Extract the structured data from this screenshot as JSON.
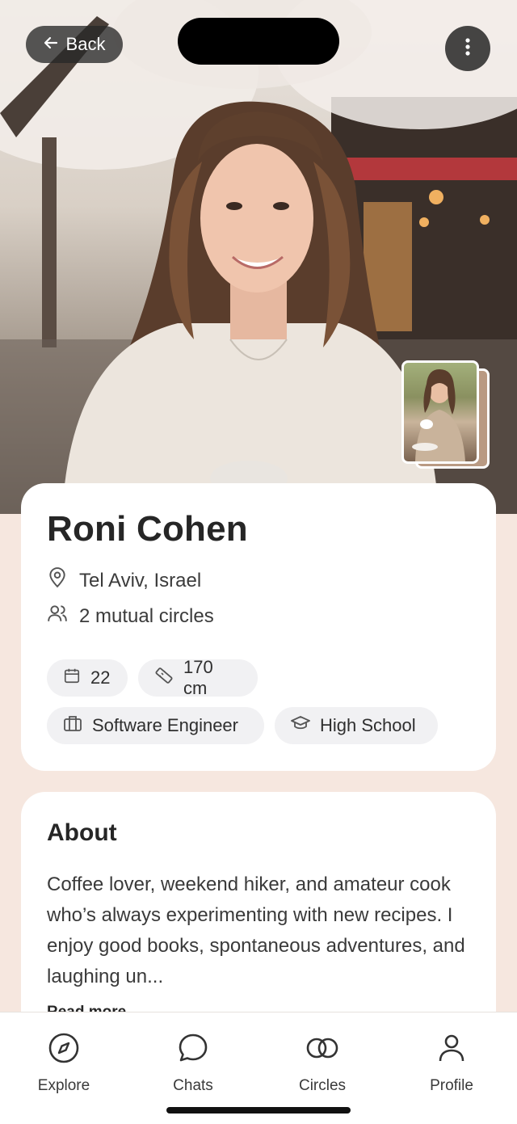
{
  "header": {
    "back_label": "Back"
  },
  "profile": {
    "name": "Roni Cohen",
    "location": "Tel Aviv, Israel",
    "mutual": "2 mutual circles",
    "chips": {
      "age": "22",
      "height": "170 cm",
      "job": "Software Engineer",
      "education": "High School"
    }
  },
  "about": {
    "title": "About",
    "text": "Coffee lover, weekend hiker, and amateur cook who’s always experimenting with new recipes. I enjoy good books, spontaneous adventures, and laughing un...",
    "read_more": "Read more"
  },
  "nav": {
    "items": [
      {
        "label": "Explore",
        "icon": "compass-icon"
      },
      {
        "label": "Chats",
        "icon": "chat-bubble-icon"
      },
      {
        "label": "Circles",
        "icon": "circles-icon"
      },
      {
        "label": "Profile",
        "icon": "person-icon"
      }
    ]
  }
}
